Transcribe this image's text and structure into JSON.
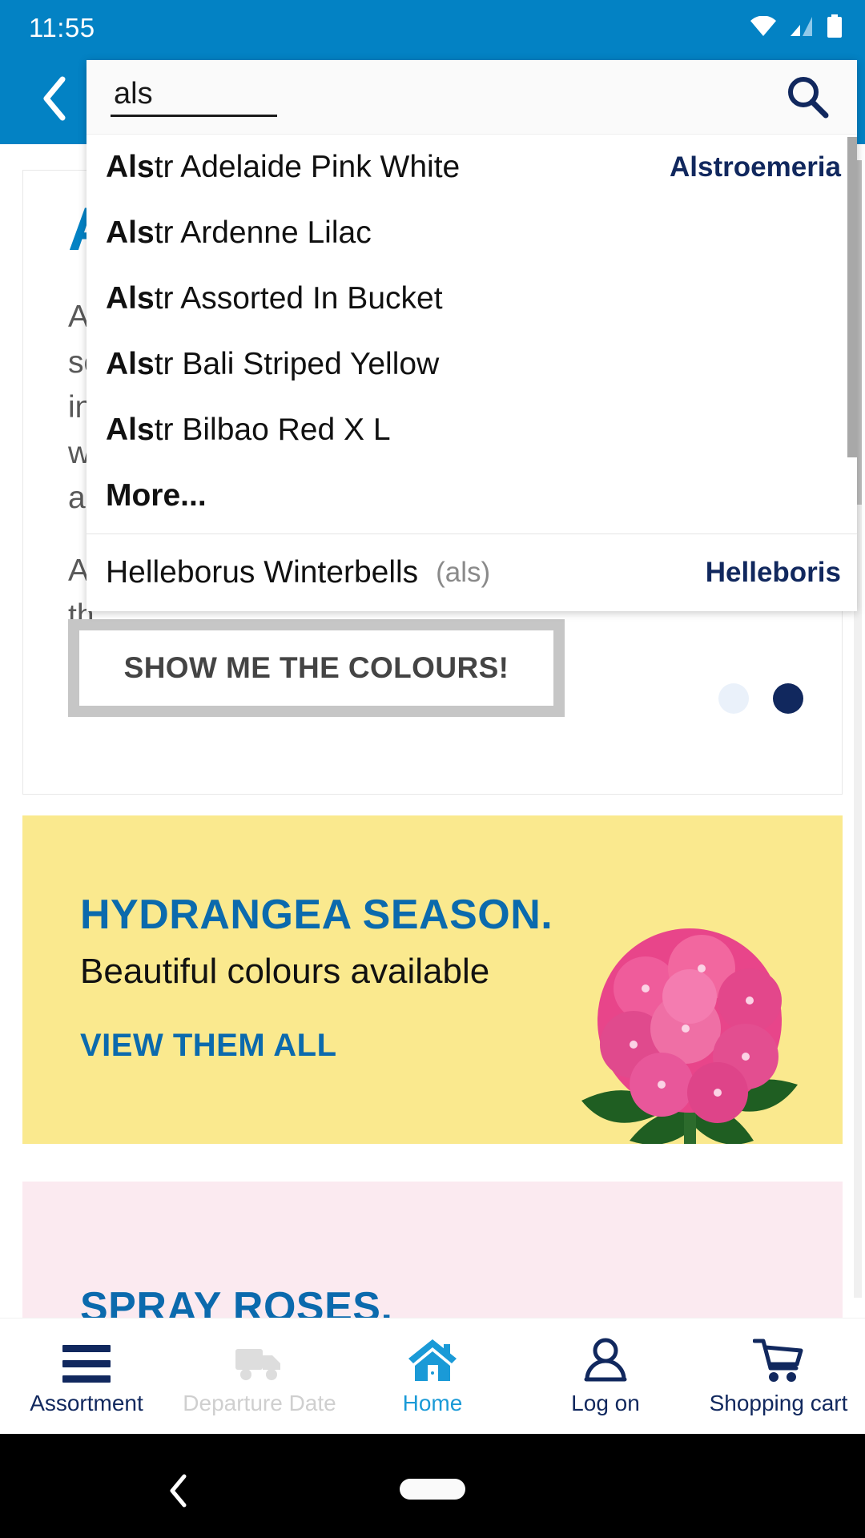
{
  "status_bar": {
    "time": "11:55",
    "icons": [
      "wifi-icon",
      "cellular-signal-icon",
      "battery-icon"
    ]
  },
  "header": {
    "back_icon": "chevron-left-icon",
    "background_color": "#0382C4"
  },
  "search": {
    "value": "als",
    "placeholder": "",
    "search_icon": "search-icon",
    "suggestions": [
      {
        "bold": "Als",
        "rest": "tr Adelaide Pink White",
        "group": "Alstroemeria"
      },
      {
        "bold": "Als",
        "rest": "tr Ardenne Lilac",
        "group": ""
      },
      {
        "bold": "Als",
        "rest": "tr Assorted In Bucket",
        "group": ""
      },
      {
        "bold": "Als",
        "rest": "tr Bali Striped Yellow",
        "group": ""
      },
      {
        "bold": "Als",
        "rest": "tr Bilbao Red X L",
        "group": ""
      }
    ],
    "more_label": "More...",
    "secondary": {
      "label": "Helleborus Winterbells",
      "alt": "(als)",
      "group": "Helleboris"
    }
  },
  "promo_card": {
    "title": "A",
    "body_line_1": "A\nso\nin\nw\na",
    "body_line_2": "A\nth",
    "button_label": "SHOW ME THE COLOURS!",
    "dots": [
      {
        "state": "inactive",
        "color": "#eaf1fa"
      },
      {
        "state": "active",
        "color": "#11285e"
      }
    ]
  },
  "hydrangea_banner": {
    "title": "HYDRANGEA SEASON.",
    "subtitle": "Beautiful colours available",
    "link_label": "VIEW THEM ALL",
    "background_color": "#FAE98E",
    "image": "pink-hydrangea-flower"
  },
  "spray_banner": {
    "title": "SPRAY ROSES.",
    "background_color": "#fbeaf0"
  },
  "tab_bar": {
    "items": [
      {
        "label": "Assortment",
        "icon": "hamburger-menu-icon",
        "state": "normal"
      },
      {
        "label": "Departure Date",
        "icon": "truck-icon",
        "state": "disabled"
      },
      {
        "label": "Home",
        "icon": "home-icon",
        "state": "active"
      },
      {
        "label": "Log on",
        "icon": "user-icon",
        "state": "normal"
      },
      {
        "label": "Shopping cart",
        "icon": "shopping-cart-icon",
        "state": "normal"
      }
    ]
  },
  "android_nav": {
    "back_icon": "chevron-left-icon",
    "home_icon": "home-pill-indicator"
  }
}
